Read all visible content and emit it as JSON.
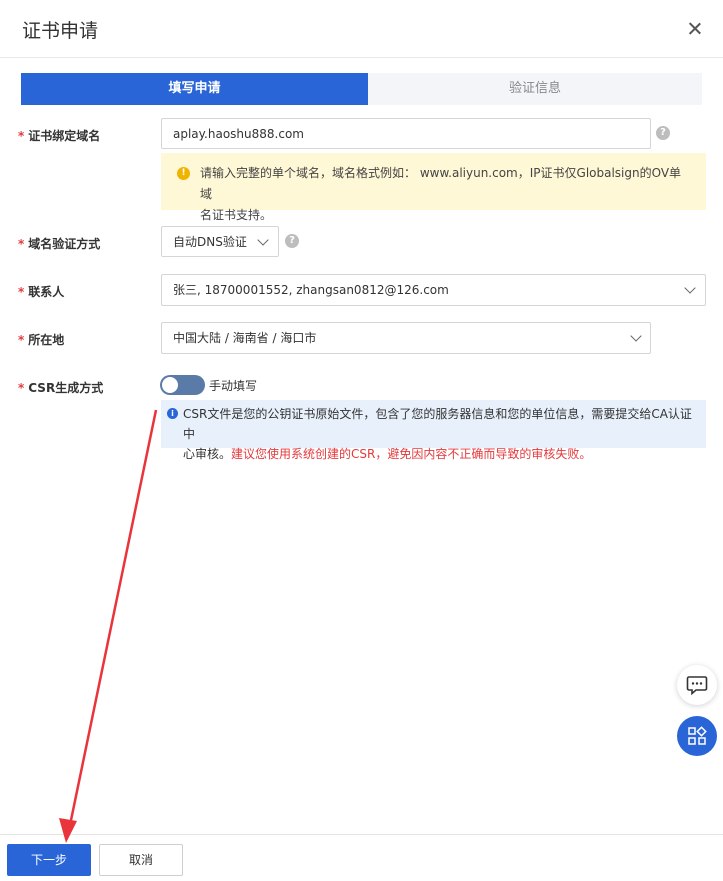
{
  "dialog": {
    "title": "证书申请"
  },
  "steps": [
    {
      "label": "填写申请",
      "active": true
    },
    {
      "label": "验证信息",
      "active": false
    }
  ],
  "form": {
    "domain": {
      "label": "证书绑定域名",
      "value": "aplay.haoshu888.com",
      "help_icon": "?",
      "warning_line1": "请输入完整的单个域名，域名格式例如： www.aliyun.com，IP证书仅Globalsign的OV单域",
      "warning_line2": "名证书支持。"
    },
    "verify_method": {
      "label": "域名验证方式",
      "value": "自动DNS验证",
      "help_icon": "?"
    },
    "contact": {
      "label": "联系人",
      "value": "张三, 18700001552, zhangsan0812@126.com"
    },
    "location": {
      "label": "所在地",
      "value": "中国大陆 / 海南省 / 海口市"
    },
    "csr": {
      "label": "CSR生成方式",
      "toggle_label": "手动填写",
      "info_line1": "CSR文件是您的公钥证书原始文件，包含了您的服务器信息和您的单位信息，需要提交给CA认证中",
      "info_line2_plain": "心审核。",
      "info_line2_red": "建议您使用系统创建的CSR，避免因内容不正确而导致的审核失败。"
    }
  },
  "footer": {
    "next_label": "下一步",
    "cancel_label": "取消"
  },
  "colors": {
    "primary": "#2a65d8",
    "warning_bg": "#fff8d6",
    "info_bg": "#e8f1fb",
    "required": "#e4393c",
    "arrow": "#e8343a"
  },
  "icons": {
    "close": "close-icon",
    "chat": "chat-icon",
    "apps": "apps-icon",
    "warning": "warning-icon",
    "info": "info-icon"
  }
}
